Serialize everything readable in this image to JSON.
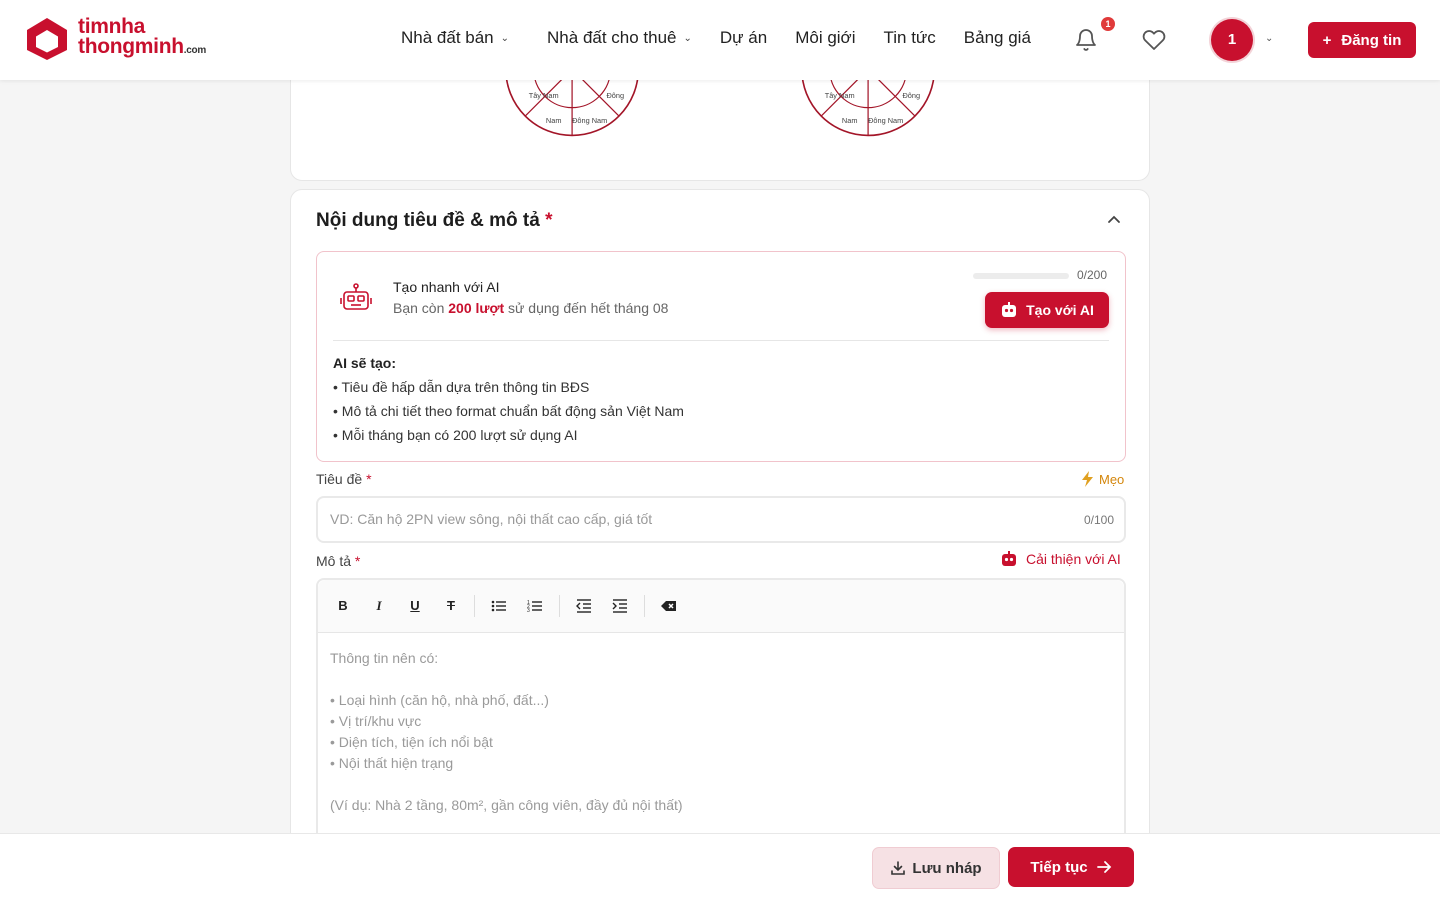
{
  "brand": {
    "line1": "timnha",
    "line2": "thongminh",
    "suffix": ".com",
    "color": "#c8102e"
  },
  "nav": [
    {
      "label": "Nhà đất bán",
      "has_dropdown": true
    },
    {
      "label": "Nhà đất cho thuê",
      "has_dropdown": true
    },
    {
      "label": "Dự án",
      "has_dropdown": false
    },
    {
      "label": "Môi giới",
      "has_dropdown": false
    },
    {
      "label": "Tin tức",
      "has_dropdown": false
    },
    {
      "label": "Bảng giá",
      "has_dropdown": false
    }
  ],
  "header": {
    "notification_count": "1",
    "avatar_label": "1",
    "post_button": "Đăng tin",
    "post_icon": "+"
  },
  "compass": {
    "left": {
      "sw": "Tây Nam",
      "e": "Đông",
      "s": "Nam",
      "se": "Đông Nam"
    },
    "right": {
      "sw": "Tây Nam",
      "e": "Đông",
      "s": "Nam",
      "se": "Đông Nam"
    }
  },
  "section": {
    "title": "Nội dung tiêu đề & mô tả",
    "required_mark": "*"
  },
  "ai": {
    "title": "Tạo nhanh với AI",
    "sub_prefix": "Bạn còn ",
    "sub_highlight": "200 lượt",
    "sub_suffix": " sử dụng đến hết tháng 08",
    "counter": "0/200",
    "usage_fraction": 0,
    "button": "Tạo với AI",
    "will_create": "AI sẽ tạo:",
    "bullets": [
      "• Tiêu đề hấp dẫn dựa trên thông tin BĐS",
      "• Mô tả chi tiết theo format chuẩn bất động sản Việt Nam",
      "• Mỗi tháng bạn có 200 lượt sử dụng AI"
    ]
  },
  "title_field": {
    "label": "Tiêu đề",
    "required_mark": "*",
    "tips": "Mẹo",
    "placeholder": "VD: Căn hộ 2PN view sông, nội thất cao cấp, giá tốt",
    "value": "",
    "counter": "0/100"
  },
  "desc_field": {
    "label": "Mô tả",
    "required_mark": "*",
    "improve": "Cải thiện với AI",
    "toolbar": [
      "bold",
      "italic",
      "underline",
      "strikethrough",
      "bullet-list",
      "numbered-list",
      "outdent",
      "indent",
      "clear-format"
    ],
    "placeholder_lines": [
      "Thông tin nên có:",
      "",
      "• Loại hình (căn hộ, nhà phố, đất...)",
      "• Vị trí/khu vực",
      "• Diện tích, tiện ích nổi bật",
      "• Nội thất hiện trạng",
      "",
      "(Ví dụ: Nhà 2 tầng, 80m², gần công viên, đầy đủ nội thất)"
    ]
  },
  "footer": {
    "draft": "Lưu nháp",
    "next": "Tiếp tục"
  }
}
